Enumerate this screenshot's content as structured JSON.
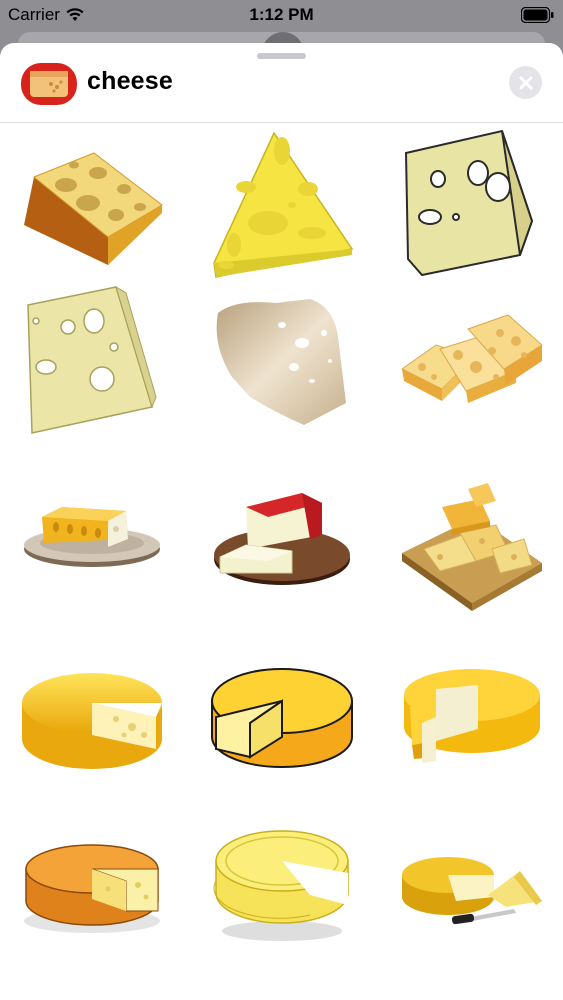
{
  "status_bar": {
    "carrier": "Carrier",
    "time": "1:12 PM"
  },
  "header": {
    "title": "cheese",
    "app_icon": "cheese-app-icon",
    "close_icon": "close-icon"
  },
  "stickers": [
    {
      "name": "cheese-wedge-orange-rind"
    },
    {
      "name": "cheese-triangle-yellow"
    },
    {
      "name": "cheese-wedge-pale-outline"
    },
    {
      "name": "cheese-wedge-pale-holes"
    },
    {
      "name": "cheese-slice-beige"
    },
    {
      "name": "cheese-chunks-pile"
    },
    {
      "name": "cheese-on-plate"
    },
    {
      "name": "cheese-wedge-red-on-board"
    },
    {
      "name": "cheese-board-assortment"
    },
    {
      "name": "cheese-wheel-cut-yellow"
    },
    {
      "name": "cheese-wheel-cut-outlined"
    },
    {
      "name": "cheese-wheel-cut-wedge"
    },
    {
      "name": "cheese-wheel-orange"
    },
    {
      "name": "cheese-wheel-light-yellow"
    },
    {
      "name": "cheese-wheel-with-knife"
    }
  ],
  "colors": {
    "sheet_background": "#ffffff",
    "backdrop": "#8e8e93",
    "close_button": "#e3e3e8",
    "cheese_yellow": "#f5d21a",
    "cheese_pale": "#e8e29a",
    "rind_orange": "#e07b1a"
  }
}
